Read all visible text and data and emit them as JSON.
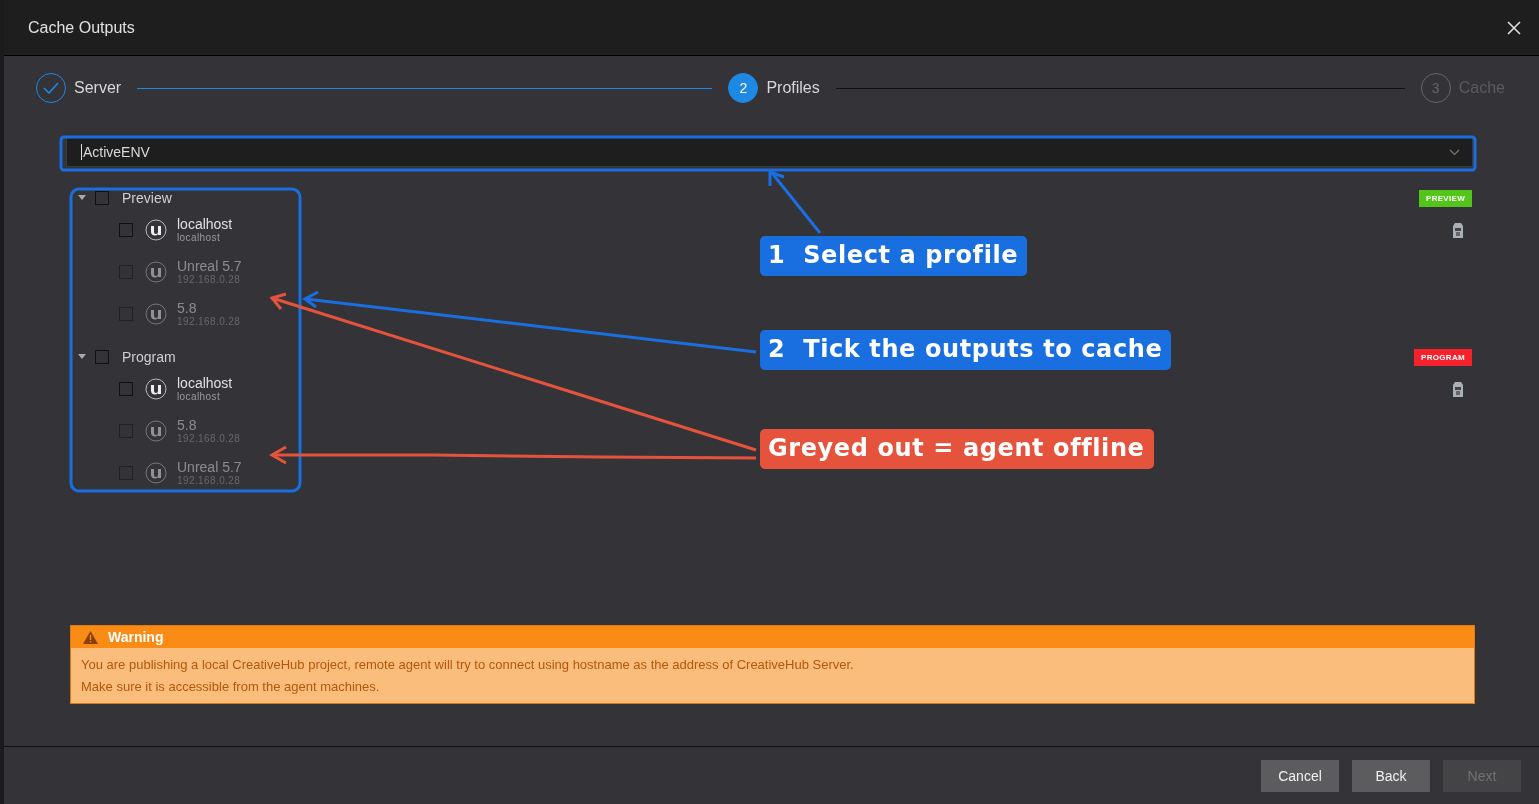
{
  "window": {
    "title": "Cache Outputs"
  },
  "steps": [
    {
      "label": "Server",
      "completed": true,
      "selected": false
    },
    {
      "number": "2",
      "label": "Profiles",
      "completed": false,
      "selected": true
    },
    {
      "number": "3",
      "label": "Cache",
      "completed": false,
      "selected": false
    }
  ],
  "profile_select": {
    "value": "ActiveENV"
  },
  "groups": [
    {
      "label": "Preview",
      "expanded": true,
      "checked": false,
      "badge": {
        "text": "PREVIEW",
        "color": "#52c41a"
      },
      "children": [
        {
          "name": "localhost",
          "address": "localhost",
          "online": true,
          "checked": false
        },
        {
          "name": "Unreal 5.7",
          "address": "192.168.0.28",
          "online": false,
          "checked": false
        },
        {
          "name": "5.8",
          "address": "192.168.0.28",
          "online": false,
          "checked": false
        }
      ]
    },
    {
      "label": "Program",
      "expanded": true,
      "checked": false,
      "badge": {
        "text": "PROGRAM",
        "color": "#f5222d"
      },
      "children": [
        {
          "name": "localhost",
          "address": "localhost",
          "online": true,
          "checked": false
        },
        {
          "name": "5.8",
          "address": "192.168.0.28",
          "online": false,
          "checked": false
        },
        {
          "name": "Unreal 5.7",
          "address": "192.168.0.28",
          "online": false,
          "checked": false
        }
      ]
    }
  ],
  "warning": {
    "title": "Warning",
    "lines": [
      "You are publishing a local CreativeHub project, remote agent will try to connect using hostname as the address of CreativeHub Server.",
      "Make sure it is accessible from the agent machines."
    ]
  },
  "buttons": [
    {
      "label": "Cancel",
      "disabled": false
    },
    {
      "label": "Back",
      "disabled": false
    },
    {
      "label": "Next",
      "disabled": true
    }
  ],
  "annotations": [
    {
      "text": "1  Select a profile",
      "color": "#1a6fe0"
    },
    {
      "text": "2  Tick the outputs to cache",
      "color": "#1a6fe0"
    },
    {
      "text": "Greyed out = agent offline",
      "color": "#e5533d"
    }
  ]
}
